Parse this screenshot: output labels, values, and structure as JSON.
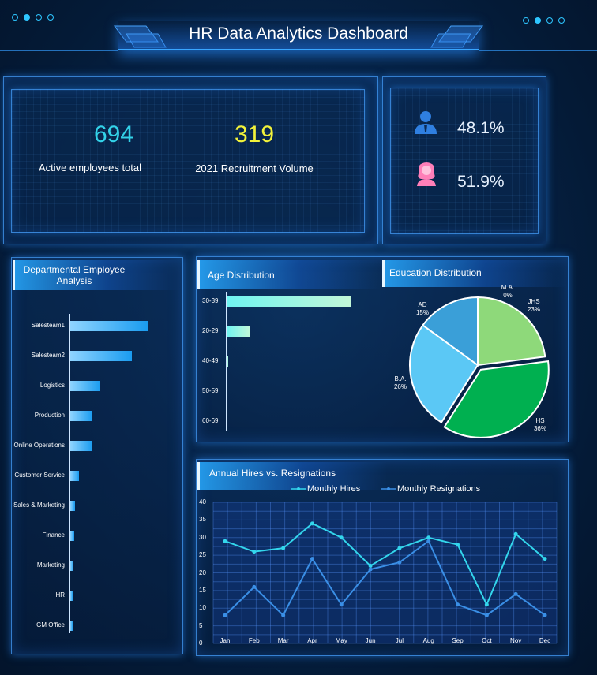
{
  "header": {
    "title": "HR Data Analytics Dashboard"
  },
  "kpis": {
    "active_employees": {
      "value": "694",
      "label": "Active employees total",
      "color": "#33d2e8"
    },
    "recruitment": {
      "value": "319",
      "label": "2021 Recruitment Volume",
      "color": "#f2f23a"
    }
  },
  "gender": {
    "male": {
      "percent": "48.1%",
      "icon": "male-user-icon",
      "color": "#2f7fe0"
    },
    "female": {
      "percent": "51.9%",
      "icon": "female-user-icon",
      "color": "#ff7fb8"
    }
  },
  "departments": {
    "title_line1": "Departmental Employee",
    "title_line2": "Analysis"
  },
  "age": {
    "title": "Age Distribution"
  },
  "education": {
    "title": "Education Distribution"
  },
  "hires": {
    "title": "Annual Hires vs. Resignations",
    "legend_hires": "Monthly Hires",
    "legend_resignations": "Monthly Resignations"
  },
  "chart_data": [
    {
      "type": "bar",
      "orientation": "horizontal",
      "title": "Departmental Employee Analysis",
      "categories": [
        "Salesteam1",
        "Salesteam2",
        "Logistics",
        "Production",
        "Online Operations",
        "Customer Service",
        "Sales & Marketing",
        "Finance",
        "Marketing",
        "HR",
        "GM Office"
      ],
      "values": [
        195,
        155,
        75,
        55,
        55,
        22,
        12,
        9,
        8,
        6,
        5
      ],
      "color": "#2aa8f0"
    },
    {
      "type": "bar",
      "orientation": "horizontal",
      "title": "Age Distribution",
      "categories": [
        "30-39",
        "20-29",
        "40-49",
        "50-59",
        "60-69"
      ],
      "values": [
        480,
        93,
        3,
        0,
        0
      ],
      "color": "#7ef0ea"
    },
    {
      "type": "pie",
      "title": "Education Distribution",
      "slices": [
        {
          "label": "M.A.",
          "display": "0%",
          "value": 0,
          "color": "#2a86d8"
        },
        {
          "label": "JHS",
          "display": "23%",
          "value": 23,
          "color": "#8ed97a"
        },
        {
          "label": "HS",
          "display": "36%",
          "value": 36,
          "color": "#00b050"
        },
        {
          "label": "B.A.",
          "display": "26%",
          "value": 26,
          "color": "#5bc8f5"
        },
        {
          "label": "AD",
          "display": "15%",
          "value": 15,
          "color": "#3a9fd8"
        }
      ]
    },
    {
      "type": "line",
      "title": "Annual Hires vs. Resignations",
      "categories": [
        "Jan",
        "Feb",
        "Mar",
        "Apr",
        "May",
        "Jun",
        "Jul",
        "Aug",
        "Sep",
        "Oct",
        "Nov",
        "Dec"
      ],
      "ylim": [
        0,
        40
      ],
      "yticks": [
        "0",
        "5",
        "10",
        "15",
        "20",
        "25",
        "30",
        "35",
        "40"
      ],
      "series": [
        {
          "name": "Monthly Hires",
          "values": [
            29,
            26,
            27,
            34,
            30,
            22,
            27,
            30,
            28,
            11,
            31,
            24
          ],
          "color": "#33d6ec"
        },
        {
          "name": "Monthly Resignations",
          "values": [
            8,
            16,
            8,
            24,
            11,
            21,
            23,
            29,
            11,
            8,
            14,
            8
          ],
          "color": "#3a8fe6"
        }
      ],
      "grid": true,
      "legend": "top"
    }
  ]
}
